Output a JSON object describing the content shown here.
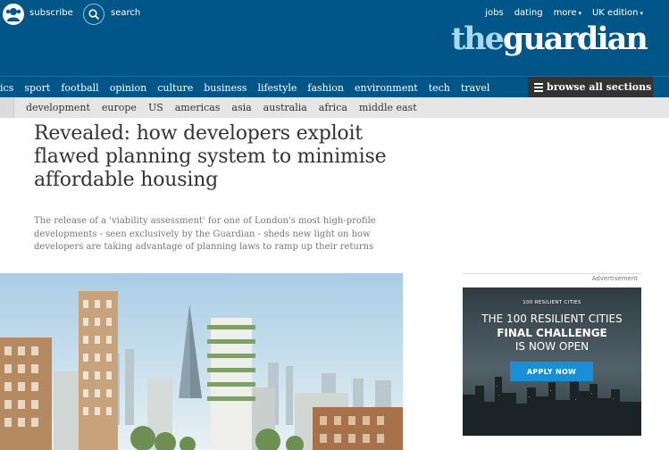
{
  "header": {
    "subscribe_label": "subscribe",
    "search_label": "search",
    "links": [
      {
        "label": "jobs"
      },
      {
        "label": "dating"
      },
      {
        "label": "more"
      },
      {
        "label": "UK edition"
      }
    ],
    "logo_the": "the",
    "logo_guardian": "guardian",
    "bg_color": "#005689"
  },
  "nav": {
    "items": [
      "ics",
      "sport",
      "football",
      "opinion",
      "culture",
      "business",
      "lifestyle",
      "fashion",
      "environment",
      "tech",
      "travel"
    ],
    "browse_label": "browse all sections"
  },
  "subnav": {
    "items": [
      "development",
      "europe",
      "US",
      "americas",
      "asia",
      "australia",
      "africa",
      "middle east"
    ]
  },
  "article": {
    "headline": "Revealed: how developers exploit flawed planning system to minimise affordable housing",
    "standfirst": "The release of a 'viability assessment' for one of London's most high-profile developments - seen exclusively by the Guardian - sheds new light on how developers are taking advantage of planning laws to ramp up their returns"
  },
  "ad": {
    "label": "Advertisement",
    "brand": "100 RESILIENT CITIES",
    "line1": "THE 100 RESILIENT CITIES",
    "line2": "FINAL CHALLENGE",
    "line3": "IS NOW OPEN",
    "button": "APPLY NOW",
    "button_color": "#1a8fd6"
  }
}
